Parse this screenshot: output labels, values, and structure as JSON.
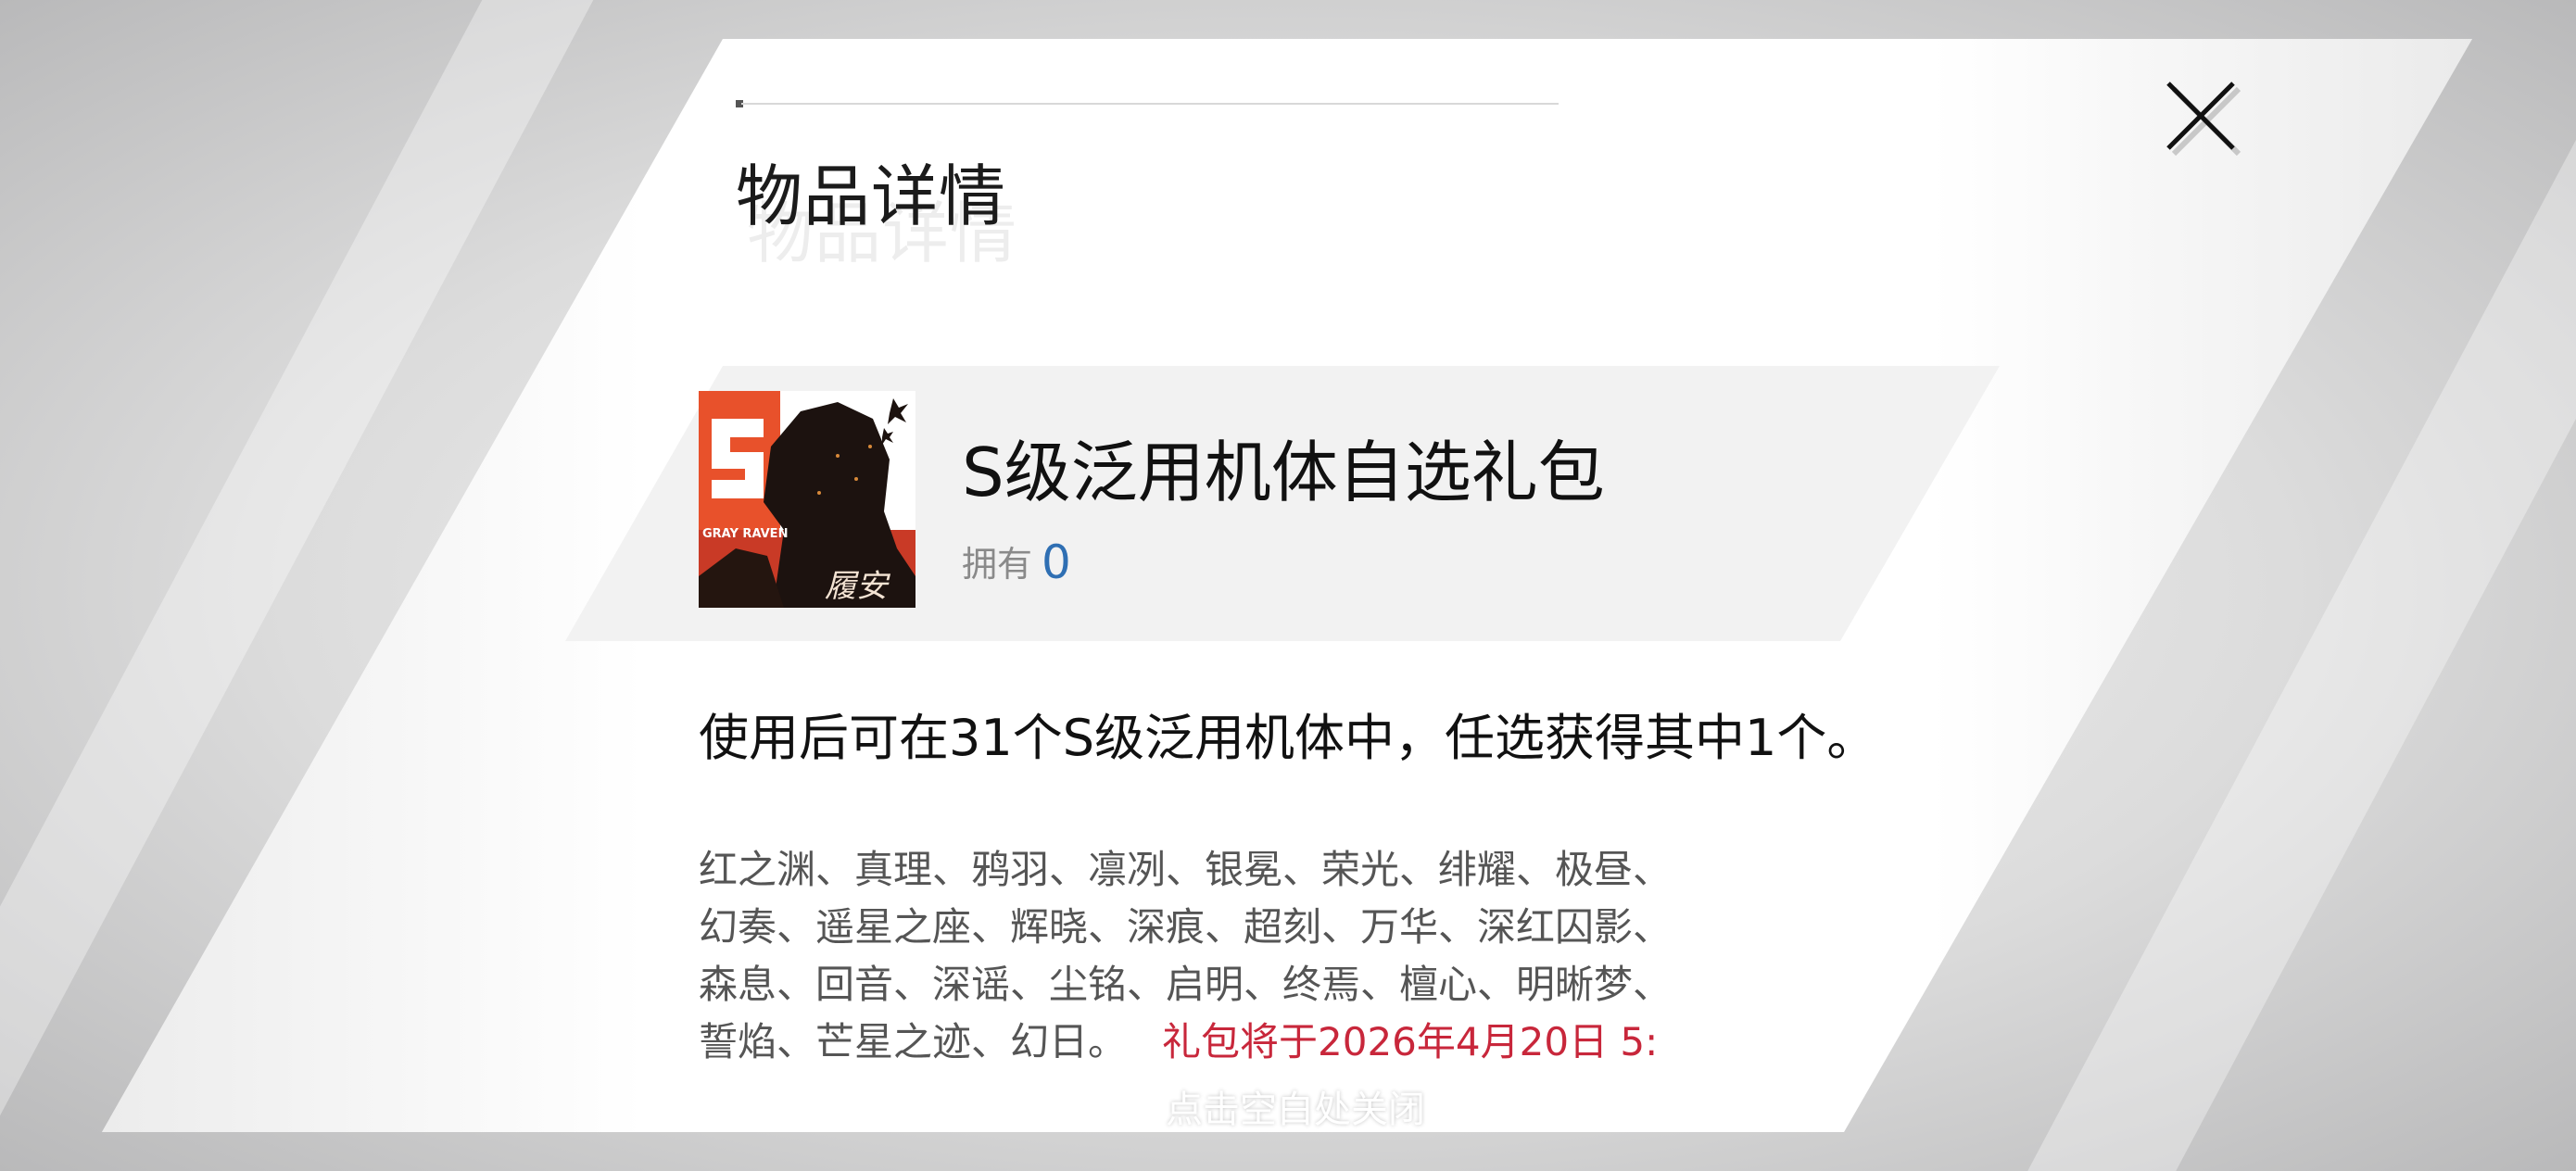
{
  "dialog": {
    "title": "物品详情",
    "close_icon": "close-icon"
  },
  "item": {
    "name": "S级泛用机体自选礼包",
    "owned_label": "拥有",
    "owned_count": "0",
    "icon": "gift-pack-character-icon",
    "icon_text": "GRAY RAVEN",
    "icon_signature": "履安"
  },
  "description": {
    "summary": "使用后可在31个S级泛用机体中，任选获得其中1个。",
    "units_line1": "红之渊、真理、鸦羽、凛冽、银冕、荣光、绯耀、极昼、",
    "units_line2": "幻奏、遥星之座、辉晓、深痕、超刻、万华、深红囚影、",
    "units_line3": "森息、回音、深谣、尘铭、启明、终焉、檀心、明晰梦、",
    "units_line4": "誓焰、芒星之迹、幻日。",
    "expiry_notice": "礼包将于2026年4月20日 5:"
  },
  "footer": {
    "tap_to_close": "点击空白处关闭"
  },
  "colors": {
    "accent_blue": "#2f6fb3",
    "notice_red": "#c8273b",
    "icon_orange": "#e8512b"
  }
}
